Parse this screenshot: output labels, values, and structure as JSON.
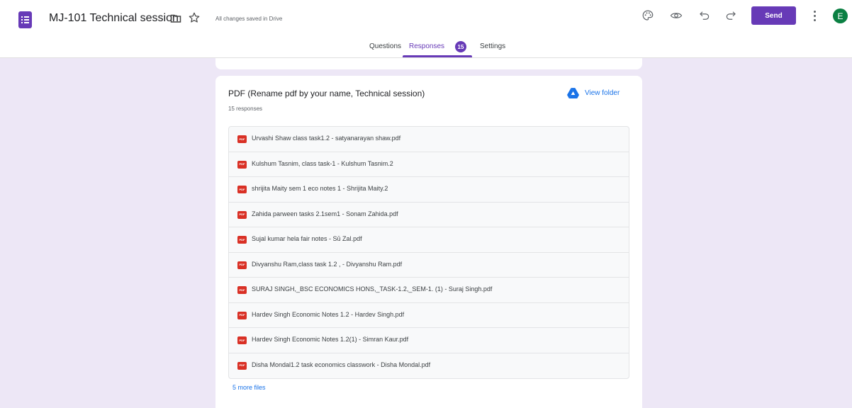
{
  "header": {
    "title": "MJ-101 Technical session",
    "save_status": "All changes saved in Drive",
    "send_label": "Send",
    "avatar_initial": "E",
    "accent_color": "#673ab7"
  },
  "tabs": [
    {
      "label": "Questions",
      "active": false
    },
    {
      "label": "Responses",
      "active": true,
      "badge": "15"
    },
    {
      "label": "Settings",
      "active": false
    }
  ],
  "question": {
    "title": "PDF (Rename pdf  by your name,  Technical session)",
    "response_count": "15 responses",
    "view_folder_label": "View folder",
    "files": [
      "Urvashi Shaw class task1.2 - satyanarayan shaw.pdf",
      "Kulshum Tasnim, class task-1 - Kulshum Tasnim.2",
      "shrijita Maity sem 1 eco notes 1 - Shrijita Maity.2",
      "Zahida parween tasks 2.1sem1 - Sonam Zahida.pdf",
      "Sujal kumar hela fair notes - Sū Zal.pdf",
      "Divyanshu Ram,class task 1.2 , - Divyanshu Ram.pdf",
      "SURAJ SINGH,_BSC ECONOMICS HONS,_TASK-1.2,_SEM-1. (1) - Suraj Singh.pdf",
      "Hardev Singh Economic Notes 1.2 - Hardev Singh.pdf",
      "Hardev Singh Economic Notes 1.2(1) - Simran Kaur.pdf",
      "Disha Mondal1.2 task economics classwork - Disha Mondal.pdf"
    ],
    "more_files_label": "5 more files",
    "file_icon_text": "PDF"
  }
}
